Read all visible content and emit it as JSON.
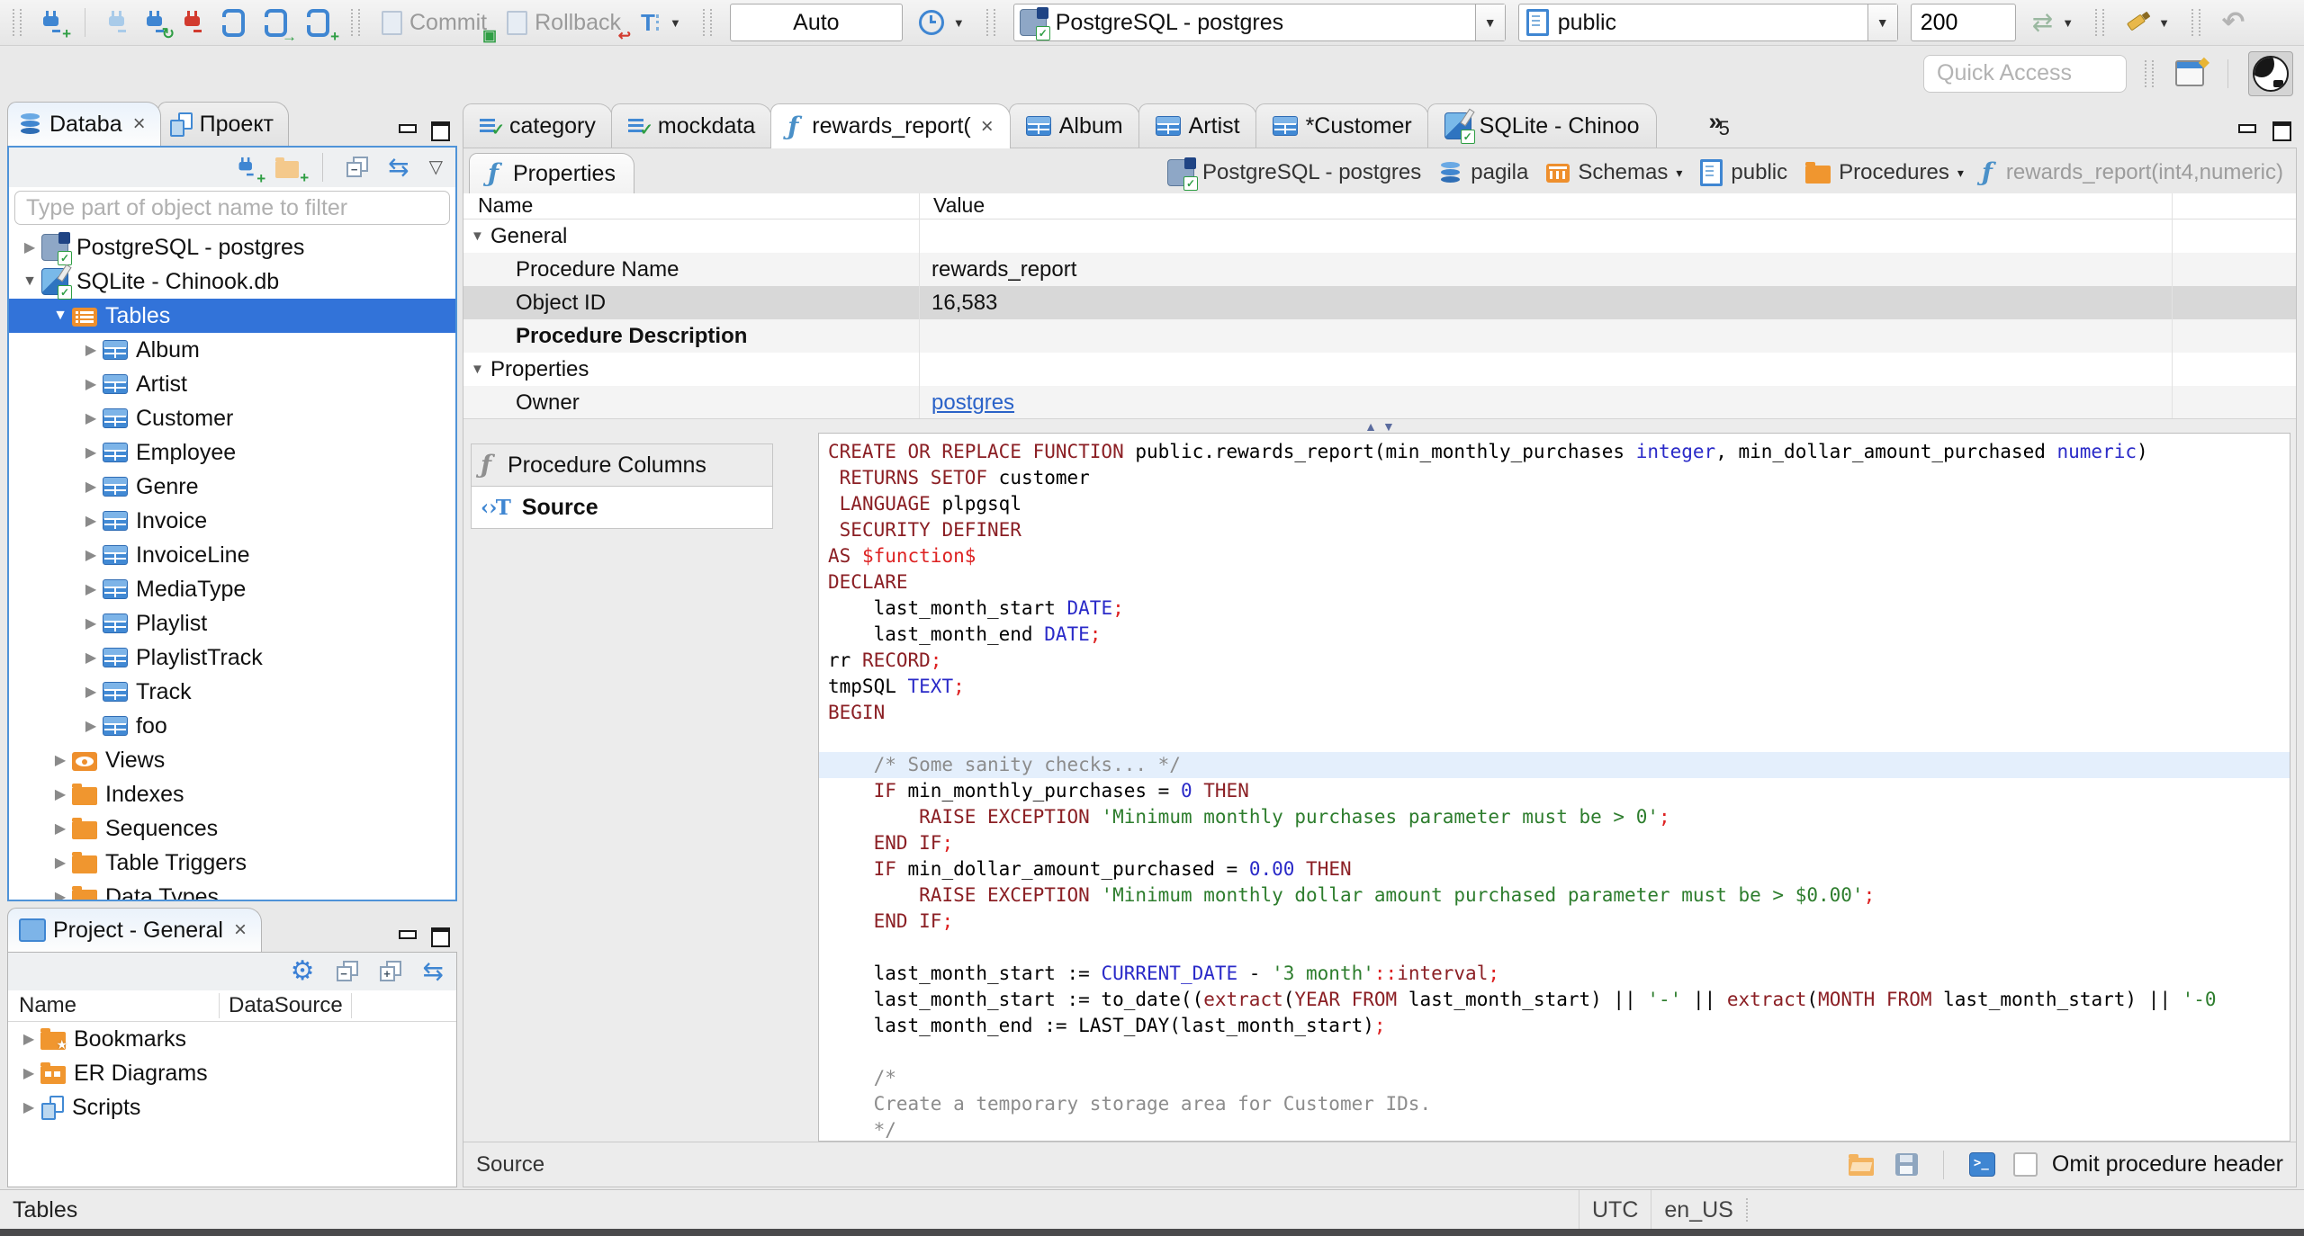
{
  "glyphs": {
    "close": "×",
    "dropdown": "▼",
    "dropdown_small": "▾",
    "collapsed": "▶",
    "expanded": "▼",
    "overflow": "»",
    "fn": "ƒ",
    "source": "‹›T",
    "gear": "⚙",
    "sync": "⇆",
    "panel_menu": "▽",
    "undo": "↶",
    "refresh": "⇄",
    "splitter_up": "▲",
    "splitter_down": "▼"
  },
  "toolbar": {
    "commit_label": "Commit",
    "rollback_label": "Rollback",
    "tx_mode_value": "Auto",
    "connection_value": "PostgreSQL - postgres",
    "schema_value": "public",
    "fetch_size_value": "200"
  },
  "quick_access_placeholder": "Quick Access",
  "view_tabs": {
    "database_label": "Databa",
    "project_label": "Проект"
  },
  "navigator": {
    "filter_placeholder": "Type part of object name to filter",
    "tree": [
      {
        "level": 0,
        "state": "collapsed",
        "icon": "postgres",
        "label": "PostgreSQL - postgres"
      },
      {
        "level": 0,
        "state": "expanded",
        "icon": "sqlite",
        "label": "SQLite - Chinook.db"
      },
      {
        "level": 1,
        "state": "expanded",
        "icon": "tablesfolder",
        "label": "Tables",
        "selected": true
      },
      {
        "level": 2,
        "state": "collapsed",
        "icon": "table",
        "label": "Album"
      },
      {
        "level": 2,
        "state": "collapsed",
        "icon": "table",
        "label": "Artist"
      },
      {
        "level": 2,
        "state": "collapsed",
        "icon": "table",
        "label": "Customer"
      },
      {
        "level": 2,
        "state": "collapsed",
        "icon": "table",
        "label": "Employee"
      },
      {
        "level": 2,
        "state": "collapsed",
        "icon": "table",
        "label": "Genre"
      },
      {
        "level": 2,
        "state": "collapsed",
        "icon": "table",
        "label": "Invoice"
      },
      {
        "level": 2,
        "state": "collapsed",
        "icon": "table",
        "label": "InvoiceLine"
      },
      {
        "level": 2,
        "state": "collapsed",
        "icon": "table",
        "label": "MediaType"
      },
      {
        "level": 2,
        "state": "collapsed",
        "icon": "table",
        "label": "Playlist"
      },
      {
        "level": 2,
        "state": "collapsed",
        "icon": "table",
        "label": "PlaylistTrack"
      },
      {
        "level": 2,
        "state": "collapsed",
        "icon": "table",
        "label": "Track"
      },
      {
        "level": 2,
        "state": "collapsed",
        "icon": "table",
        "label": "foo"
      },
      {
        "level": 1,
        "state": "collapsed",
        "icon": "views",
        "label": "Views"
      },
      {
        "level": 1,
        "state": "collapsed",
        "icon": "folder",
        "label": "Indexes"
      },
      {
        "level": 1,
        "state": "collapsed",
        "icon": "folder",
        "label": "Sequences"
      },
      {
        "level": 1,
        "state": "collapsed",
        "icon": "folder",
        "label": "Table Triggers"
      },
      {
        "level": 1,
        "state": "collapsed",
        "icon": "folder",
        "label": "Data Types"
      }
    ]
  },
  "project_panel": {
    "title": "Project - General",
    "columns": [
      "Name",
      "DataSource"
    ],
    "rows": [
      {
        "icon": "bookmarks",
        "label": "Bookmarks"
      },
      {
        "icon": "erd",
        "label": "ER Diagrams"
      },
      {
        "icon": "scripts",
        "label": "Scripts"
      }
    ]
  },
  "editor_tabs": {
    "tabs": [
      {
        "icon": "mock",
        "label": "category"
      },
      {
        "icon": "mock",
        "label": "mockdata"
      },
      {
        "icon": "fn",
        "label": "rewards_report(",
        "active": true,
        "closable": true
      },
      {
        "icon": "table",
        "label": "Album"
      },
      {
        "icon": "table",
        "label": "Artist"
      },
      {
        "icon": "table",
        "label": "*Customer"
      },
      {
        "icon": "sqlite",
        "label": "SQLite - Chinoo"
      }
    ],
    "overflow_count": "5"
  },
  "object_editor": {
    "properties_tab_label": "Properties",
    "breadcrumbs": [
      {
        "icon": "postgres",
        "label": "PostgreSQL - postgres"
      },
      {
        "icon": "dbstack",
        "label": "pagila"
      },
      {
        "icon": "schemas",
        "label": "Schemas",
        "dropdown": true
      },
      {
        "icon": "page",
        "label": "public"
      },
      {
        "icon": "folder",
        "label": "Procedures",
        "dropdown": true
      },
      {
        "icon": "fn",
        "label": "rewards_report(int4,numeric)",
        "disabled": true
      }
    ],
    "grid": {
      "name_header": "Name",
      "value_header": "Value",
      "rows": [
        {
          "name": "General",
          "type": "group",
          "value": ""
        },
        {
          "name": "Procedure Name",
          "value": "rewards_report"
        },
        {
          "name": "Object ID",
          "value": "16,583",
          "selected": true
        },
        {
          "name": "Procedure Description",
          "bold": true,
          "value": ""
        },
        {
          "name": "Properties",
          "type": "group",
          "value": ""
        },
        {
          "name": "Owner",
          "value": "postgres",
          "link": true
        }
      ]
    },
    "subtabs": [
      {
        "icon": "fn-gray",
        "label": "Procedure Columns"
      },
      {
        "icon": "source",
        "label": "Source",
        "active": true
      }
    ],
    "footer": {
      "label": "Source",
      "checkbox_label": "Omit procedure header"
    }
  },
  "source_code": {
    "lines": [
      {
        "tokens": [
          [
            "k",
            "CREATE OR REPLACE FUNCTION"
          ],
          [
            "d",
            " public.rewards_report(min_monthly_purchases "
          ],
          [
            "t",
            "integer"
          ],
          [
            "d",
            ", min_dollar_amount_purchased "
          ],
          [
            "t",
            "numeric"
          ],
          [
            "d",
            ")"
          ]
        ]
      },
      {
        "tokens": [
          [
            "d",
            " "
          ],
          [
            "k",
            "RETURNS SETOF"
          ],
          [
            "d",
            " customer"
          ]
        ]
      },
      {
        "tokens": [
          [
            "d",
            " "
          ],
          [
            "k",
            "LANGUAGE"
          ],
          [
            "d",
            " plpgsql"
          ]
        ]
      },
      {
        "tokens": [
          [
            "d",
            " "
          ],
          [
            "k",
            "SECURITY DEFINER"
          ]
        ]
      },
      {
        "tokens": [
          [
            "k",
            "AS"
          ],
          [
            "f",
            " $function$"
          ]
        ]
      },
      {
        "tokens": [
          [
            "k",
            "DECLARE"
          ]
        ]
      },
      {
        "tokens": [
          [
            "d",
            "    last_month_start "
          ],
          [
            "t",
            "DATE"
          ],
          [
            "p",
            ";"
          ]
        ]
      },
      {
        "tokens": [
          [
            "d",
            "    last_month_end "
          ],
          [
            "t",
            "DATE"
          ],
          [
            "p",
            ";"
          ]
        ]
      },
      {
        "tokens": [
          [
            "d",
            "rr "
          ],
          [
            "k",
            "RECORD"
          ],
          [
            "p",
            ";"
          ]
        ]
      },
      {
        "tokens": [
          [
            "d",
            "tmpSQL "
          ],
          [
            "t",
            "TEXT"
          ],
          [
            "p",
            ";"
          ]
        ]
      },
      {
        "tokens": [
          [
            "k",
            "BEGIN"
          ]
        ]
      },
      {
        "tokens": []
      },
      {
        "highlight": true,
        "tokens": [
          [
            "c",
            "    /* Some sanity checks... */"
          ]
        ]
      },
      {
        "tokens": [
          [
            "d",
            "    "
          ],
          [
            "k",
            "IF"
          ],
          [
            "d",
            " min_monthly_purchases = "
          ],
          [
            "t",
            "0"
          ],
          [
            "d",
            " "
          ],
          [
            "k",
            "THEN"
          ]
        ]
      },
      {
        "tokens": [
          [
            "d",
            "        "
          ],
          [
            "k",
            "RAISE EXCEPTION"
          ],
          [
            "d",
            " "
          ],
          [
            "s",
            "'Minimum monthly purchases parameter must be > 0'"
          ],
          [
            "p",
            ";"
          ]
        ]
      },
      {
        "tokens": [
          [
            "d",
            "    "
          ],
          [
            "k",
            "END IF"
          ],
          [
            "p",
            ";"
          ]
        ]
      },
      {
        "tokens": [
          [
            "d",
            "    "
          ],
          [
            "k",
            "IF"
          ],
          [
            "d",
            " min_dollar_amount_purchased = "
          ],
          [
            "t",
            "0.00"
          ],
          [
            "d",
            " "
          ],
          [
            "k",
            "THEN"
          ]
        ]
      },
      {
        "tokens": [
          [
            "d",
            "        "
          ],
          [
            "k",
            "RAISE EXCEPTION"
          ],
          [
            "d",
            " "
          ],
          [
            "s",
            "'Minimum monthly dollar amount purchased parameter must be > $0.00'"
          ],
          [
            "p",
            ";"
          ]
        ]
      },
      {
        "tokens": [
          [
            "d",
            "    "
          ],
          [
            "k",
            "END IF"
          ],
          [
            "p",
            ";"
          ]
        ]
      },
      {
        "tokens": []
      },
      {
        "tokens": [
          [
            "d",
            "    last_month_start := "
          ],
          [
            "t",
            "CURRENT_DATE"
          ],
          [
            "d",
            " - "
          ],
          [
            "s",
            "'3 month'"
          ],
          [
            "p",
            "::"
          ],
          [
            "k",
            "interval"
          ],
          [
            "p",
            ";"
          ]
        ]
      },
      {
        "tokens": [
          [
            "d",
            "    last_month_start := to_date(("
          ],
          [
            "k",
            "extract"
          ],
          [
            "d",
            "("
          ],
          [
            "k",
            "YEAR FROM"
          ],
          [
            "d",
            " last_month_start) || "
          ],
          [
            "s",
            "'-'"
          ],
          [
            "d",
            " || "
          ],
          [
            "k",
            "extract"
          ],
          [
            "d",
            "("
          ],
          [
            "k",
            "MONTH FROM"
          ],
          [
            "d",
            " last_month_start) || "
          ],
          [
            "s",
            "'-0"
          ]
        ]
      },
      {
        "tokens": [
          [
            "d",
            "    last_month_end := LAST_DAY(last_month_start)"
          ],
          [
            "p",
            ";"
          ]
        ]
      },
      {
        "tokens": []
      },
      {
        "tokens": [
          [
            "c",
            "    /*"
          ]
        ]
      },
      {
        "tokens": [
          [
            "c",
            "    Create a temporary storage area for Customer IDs."
          ]
        ]
      },
      {
        "tokens": [
          [
            "c",
            "    */"
          ]
        ]
      }
    ]
  },
  "statusbar": {
    "left": "Tables",
    "timezone": "UTC",
    "locale": "en_US"
  }
}
